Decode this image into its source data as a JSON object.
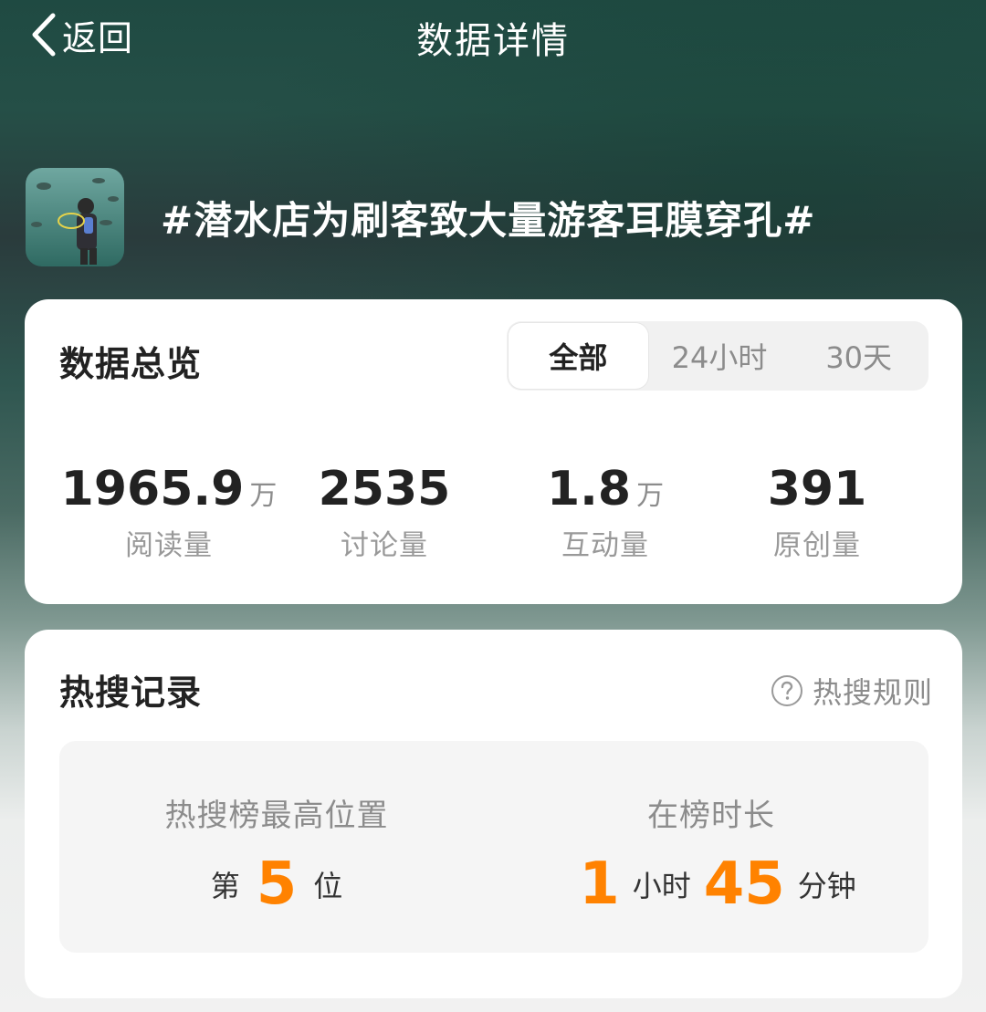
{
  "header": {
    "back_label": "返回",
    "title": "数据详情"
  },
  "topic": {
    "title": "#潜水店为刷客致大量游客耳膜穿孔#",
    "thumbnail_icon": "diver-thumbnail-image"
  },
  "overview": {
    "title": "数据总览",
    "tabs": [
      {
        "label": "全部",
        "active": true
      },
      {
        "label": "24小时",
        "active": false
      },
      {
        "label": "30天",
        "active": false
      }
    ],
    "stats": [
      {
        "value": "1965.9",
        "unit": "万",
        "label": "阅读量"
      },
      {
        "value": "2535",
        "unit": "",
        "label": "讨论量"
      },
      {
        "value": "1.8",
        "unit": "万",
        "label": "互动量"
      },
      {
        "value": "391",
        "unit": "",
        "label": "原创量"
      }
    ]
  },
  "hot_search": {
    "title": "热搜记录",
    "rules_label": "热搜规则",
    "rules_icon": "question-circle-icon",
    "best_position": {
      "label": "热搜榜最高位置",
      "prefix": "第",
      "value": "5",
      "suffix": "位"
    },
    "duration": {
      "label": "在榜时长",
      "hours": "1",
      "hours_unit": "小时",
      "minutes": "45",
      "minutes_unit": "分钟"
    }
  },
  "colors": {
    "accent": "#ff8200",
    "card_bg": "#ffffff",
    "muted_text": "#8c8c8c",
    "primary_text": "#222222"
  }
}
